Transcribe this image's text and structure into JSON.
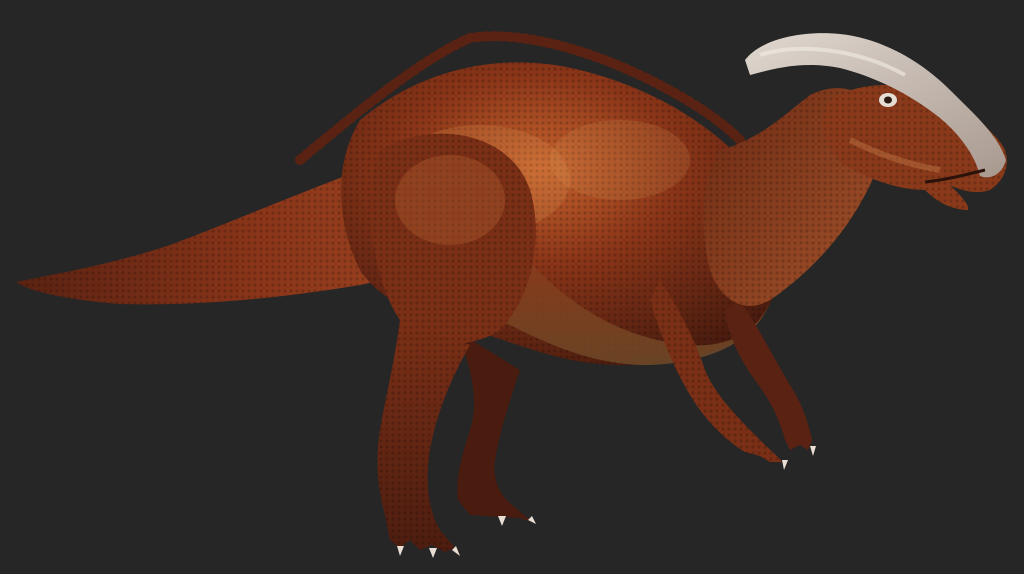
{
  "scene": {
    "background_color": "#262626",
    "subject": "parasaurolophus-icon",
    "palette": {
      "skin_dark": "#4a1d10",
      "skin_mid": "#7a2f16",
      "skin_light": "#b4522a",
      "highlight": "#d98a4a",
      "belly": "#8a5a30",
      "crest": "#cfc5bc",
      "crest_shadow": "#9c8f86",
      "claw": "#e8ded4"
    }
  }
}
